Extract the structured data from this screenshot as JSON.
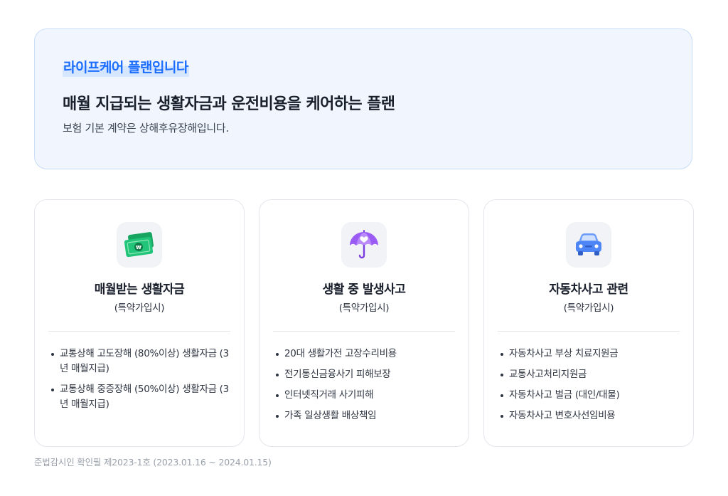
{
  "hero": {
    "badge": "라이프케어 플랜입니다",
    "title": "매월 지급되는 생활자금과 운전비용을 케어하는 플랜",
    "subtitle": "보험 기본 계약은 상해후유장해입니다."
  },
  "cards": [
    {
      "icon": "money-icon",
      "title": "매월받는 생활자금",
      "tag": "(특약가입시)",
      "items": [
        "교통상해 고도장해 (80%이상) 생활자금 (3년 매월지급)",
        "교통상해 중증장해 (50%이상) 생활자금 (3년 매월지급)"
      ]
    },
    {
      "icon": "umbrella-icon",
      "title": "생활 중 발생사고",
      "tag": "(특약가입시)",
      "items": [
        "20대 생활가전 고장수리비용",
        "전기통신금융사기 피해보장",
        "인터넷직거래 사기피해",
        "가족 일상생활 배상책임"
      ]
    },
    {
      "icon": "car-icon",
      "title": "자동차사고 관련",
      "tag": "(특약가입시)",
      "items": [
        "자동차사고 부상 치료지원금",
        "교통사고처리지원금",
        "자동차사고 벌금 (대인/대물)",
        "자동차사고 변호사선임비용"
      ]
    }
  ],
  "footnote": "준법감시인 확인필 제2023-1호 (2023.01.16 ~ 2024.01.15)",
  "colors": {
    "accent": "#1a6dff",
    "hero_bg": "#f1f6fe",
    "money_green": "#1fb86e",
    "umbrella_purple": "#9b5cf6",
    "car_blue": "#4f86f7"
  }
}
